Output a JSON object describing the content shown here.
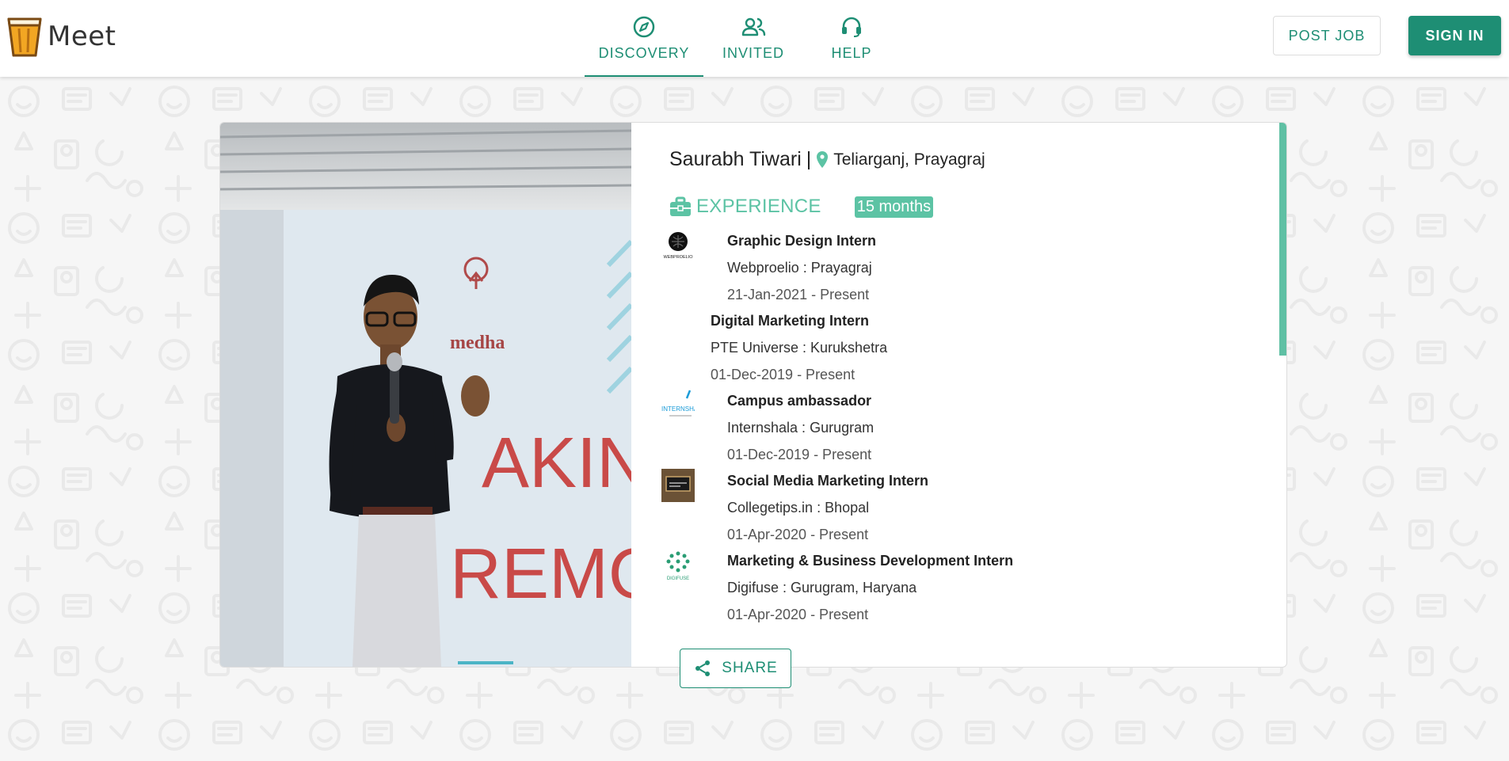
{
  "app": {
    "logo_text": "Meet"
  },
  "nav": {
    "discovery": "DISCOVERY",
    "invited": "INVITED",
    "help": "HELP"
  },
  "header": {
    "post_job": "POST JOB",
    "sign_in": "SIGN IN"
  },
  "profile": {
    "name": "Saurabh Tiwari",
    "separator": "|",
    "location": "Teliarganj, Prayagraj",
    "experience_label": "EXPERIENCE",
    "experience_duration": "15 months"
  },
  "photo": {
    "banner_logo_text": "medha",
    "banner_line1": "AKING",
    "banner_line2": "REMONY"
  },
  "experience": [
    {
      "title": "Graphic Design Intern",
      "org": "Webproelio : Prayagraj",
      "dates": "21-Jan-2021 - Present",
      "logo_text": "WEBPROELIO"
    },
    {
      "title": "Digital Marketing Intern",
      "org": "PTE Universe : Kurukshetra",
      "dates": "01-Dec-2019 - Present"
    },
    {
      "title": "Campus ambassador",
      "org": "Internshala : Gurugram",
      "dates": "01-Dec-2019 - Present",
      "logo_text": "INTERNSHALA"
    },
    {
      "title": "Social Media Marketing Intern",
      "org": "Collegetips.in : Bhopal",
      "dates": "01-Apr-2020 - Present"
    },
    {
      "title": "Marketing & Business Development Intern",
      "org": "Digifuse : Gurugram, Haryana",
      "dates": "01-Apr-2020 - Present",
      "logo_text": "DIGIFUSE"
    }
  ],
  "share": {
    "label": "SHARE"
  },
  "colors": {
    "accent": "#1e8e74",
    "accent_light": "#5cc3a4"
  }
}
